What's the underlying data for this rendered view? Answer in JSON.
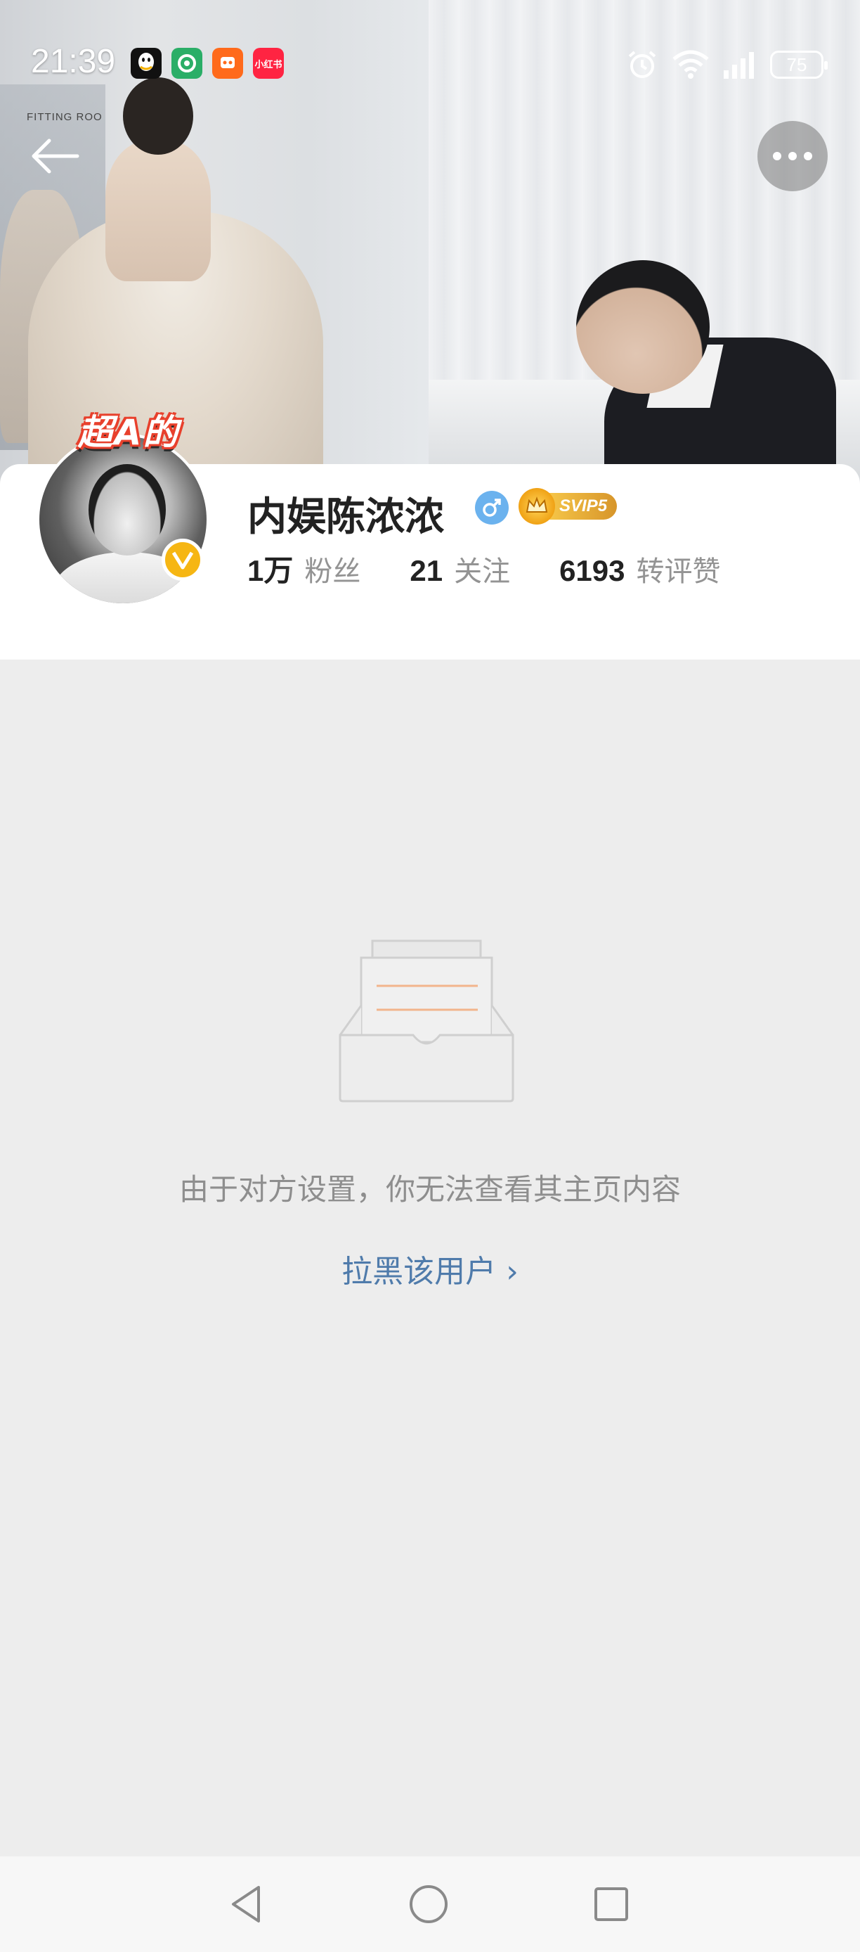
{
  "status_bar": {
    "time": "21:39",
    "notification_apps": [
      {
        "name": "qq-icon",
        "color": "#111111"
      },
      {
        "name": "wechat-pay-icon",
        "color": "#2aae67"
      },
      {
        "name": "taobao-live-icon",
        "color": "#ff6a1b"
      },
      {
        "name": "xiaohongshu-icon",
        "color": "#ff2442",
        "text": "小红书"
      }
    ],
    "battery_level": "75",
    "icons": [
      "alarm-icon",
      "wifi-icon",
      "signal-icon",
      "battery-icon"
    ]
  },
  "cover": {
    "sign_text": "FITTING ROO",
    "avatar_sticker": "超A的"
  },
  "profile": {
    "name": "内娱陈浓浓",
    "gender": "male",
    "vip_label": "SVIP5",
    "verified_color": "#f6b613",
    "stats": [
      {
        "num": "1万",
        "label": "粉丝"
      },
      {
        "num": "21",
        "label": "关注"
      },
      {
        "num": "6193",
        "label": "转评赞"
      }
    ]
  },
  "empty_state": {
    "message": "由于对方设置，你无法查看其主页内容",
    "action_label": "拉黑该用户",
    "action_chevron": "›",
    "action_color": "#4f7bab"
  },
  "nav_bar": {
    "buttons": [
      "back-triangle-icon",
      "home-circle-icon",
      "recents-square-icon"
    ]
  }
}
